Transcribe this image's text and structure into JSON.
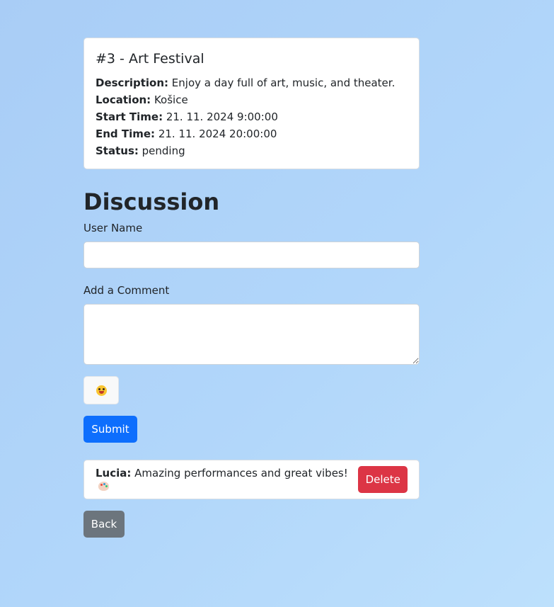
{
  "event": {
    "title": "#3 - Art Festival",
    "description_label": "Description:",
    "description": "Enjoy a day full of art, music, and theater.",
    "location_label": "Location:",
    "location": "Košice",
    "start_label": "Start Time:",
    "start_time": "21. 11. 2024 9:00:00",
    "end_label": "End Time:",
    "end_time": "21. 11. 2024 20:00:00",
    "status_label": "Status:",
    "status": "pending"
  },
  "discussion": {
    "title": "Discussion",
    "user_name_label": "User Name",
    "user_name_value": "",
    "comment_label": "Add a Comment",
    "comment_value": "",
    "emoji_icon": "grinning-face-icon",
    "submit_label": "Submit"
  },
  "comments": [
    {
      "author": "Lucia:",
      "text": "Amazing performances and great vibes!",
      "emoji_icon": "artist-palette-icon",
      "delete_label": "Delete"
    }
  ],
  "back_label": "Back",
  "colors": {
    "primary": "#0d6efd",
    "danger": "#dc3545",
    "secondary": "#6c757d",
    "background": "#b1d6fa"
  }
}
